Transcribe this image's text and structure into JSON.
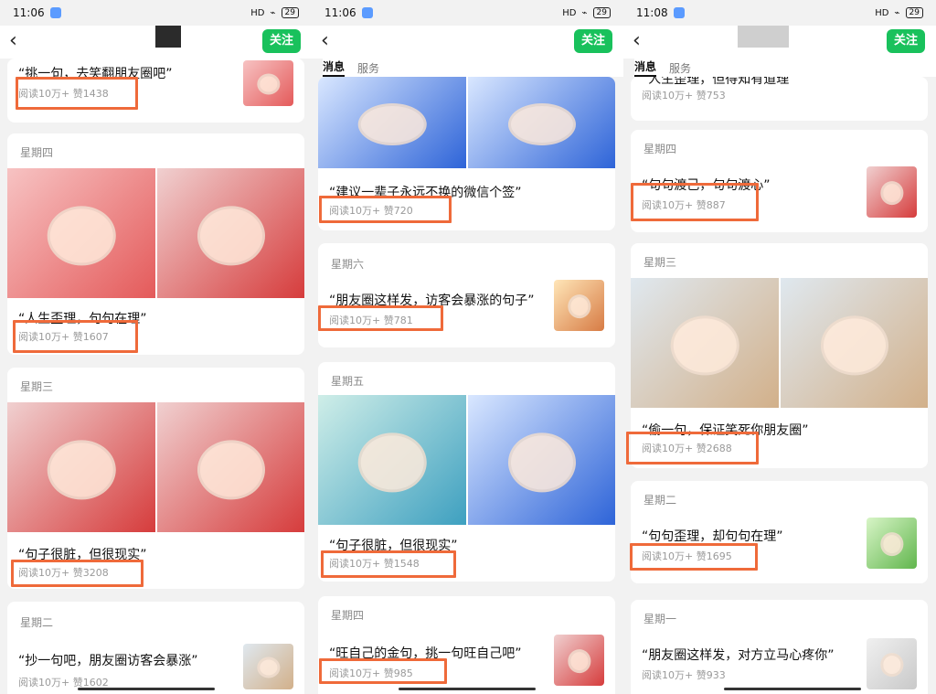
{
  "panels": [
    {
      "status": {
        "time": "11:06",
        "net": "HD",
        "battery": "29"
      },
      "follow_label": "关注",
      "cards": [
        {
          "day": "",
          "quote": "“挑一句，去笑翻朋友圈吧”",
          "stats": "阅读10万+  赞1438"
        },
        {
          "day": "星期四",
          "quote": "“人生歪理，句句在理”",
          "stats": "阅读10万+  赞1607"
        },
        {
          "day": "星期三",
          "quote": "“句子很脏，但很现实”",
          "stats": "阅读10万+  赞3208"
        },
        {
          "day": "星期二",
          "quote": "“抄一句吧，朋友圈访客会暴涨”",
          "stats": "阅读10万+  赞1602"
        }
      ]
    },
    {
      "status": {
        "time": "11:06",
        "net": "HD",
        "battery": "29"
      },
      "follow_label": "关注",
      "tabs": [
        "消息",
        "服务"
      ],
      "cards": [
        {
          "day": "",
          "quote": "“建议一辈子永远不换的微信个签”",
          "stats": "阅读10万+  赞720"
        },
        {
          "day": "星期六",
          "quote": "“朋友圈这样发，访客会暴涨的句子”",
          "stats": "阅读10万+  赞781"
        },
        {
          "day": "星期五",
          "quote": "“句子很脏，但很现实”",
          "stats": "阅读10万+  赞1548"
        },
        {
          "day": "星期四",
          "quote": "“旺自己的金句，挑一句旺自己吧”",
          "stats": "阅读10万+  赞985"
        }
      ]
    },
    {
      "status": {
        "time": "11:08",
        "net": "HD",
        "battery": "29"
      },
      "follow_label": "关注",
      "tabs": [
        "消息",
        "服务"
      ],
      "cards": [
        {
          "day": "",
          "quote": "“人生歪理，但得知有道理”",
          "stats": "阅读10万+  赞753"
        },
        {
          "day": "星期四",
          "quote": "“句句渡己，句句渡心”",
          "stats": "阅读10万+  赞887"
        },
        {
          "day": "星期三",
          "quote": "“偷一句，保证笑死你朋友圈”",
          "stats": "阅读10万+  赞2688"
        },
        {
          "day": "星期二",
          "quote": "“句句歪理，却句句在理”",
          "stats": "阅读10万+  赞1695"
        },
        {
          "day": "星期一",
          "quote": "“朋友圈这样发，对方立马心疼你”",
          "stats": "阅读10万+  赞933"
        }
      ]
    }
  ]
}
